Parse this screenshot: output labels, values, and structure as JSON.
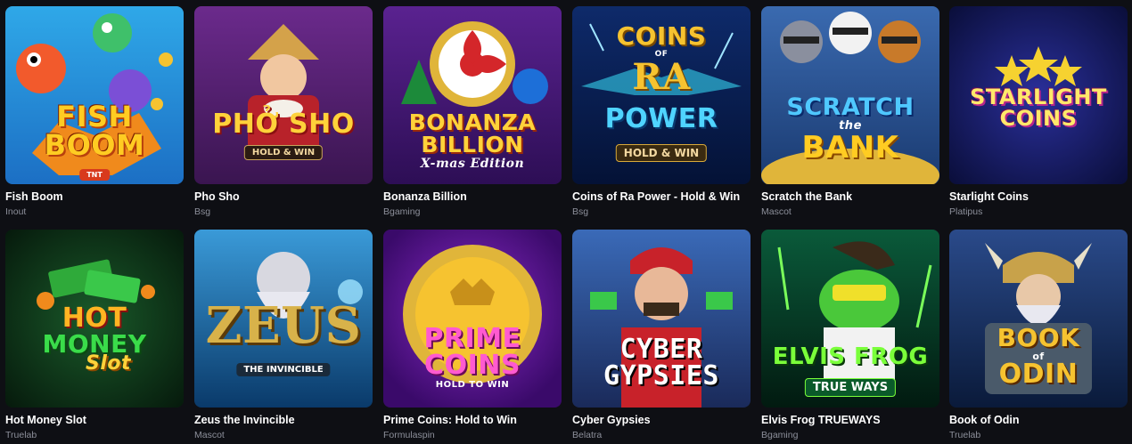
{
  "games": [
    {
      "title": "Fish Boom",
      "provider": "Inout",
      "logo": [
        "FISH",
        "BOOM"
      ],
      "logo_sub": "TNT"
    },
    {
      "title": "Pho Sho",
      "provider": "Bsg",
      "logo": [
        "PHỞ SHO"
      ],
      "badge": "HOLD & WIN"
    },
    {
      "title": "Bonanza Billion",
      "provider": "Bgaming",
      "logo": [
        "BONANZA",
        "BILLION"
      ],
      "logo_sub": "X-mas Edition"
    },
    {
      "title": "Coins of Ra Power - Hold & Win",
      "provider": "Bsg",
      "logo": [
        "COINS",
        "RA",
        "POWER"
      ],
      "logo_of": "OF",
      "badge": "HOLD & WIN"
    },
    {
      "title": "Scratch the Bank",
      "provider": "Mascot",
      "logo": [
        "SCRATCH",
        "BANK"
      ],
      "logo_the": "the"
    },
    {
      "title": "Starlight Coins",
      "provider": "Platipus",
      "logo": [
        "STARLIGHT",
        "COINS"
      ]
    },
    {
      "title": "Hot Money Slot",
      "provider": "Truelab",
      "logo": [
        "HOT",
        "MONEY"
      ],
      "logo_sub": "Slot"
    },
    {
      "title": "Zeus the Invincible",
      "provider": "Mascot",
      "logo": [
        "ZEUS"
      ],
      "logo_sub": "THE INVINCIBLE"
    },
    {
      "title": "Prime Coins: Hold to Win",
      "provider": "Formulaspin",
      "logo": [
        "PRIME",
        "COINS"
      ],
      "logo_sub": "HOLD TO WIN"
    },
    {
      "title": "Cyber Gypsies",
      "provider": "Belatra",
      "logo": [
        "CYBER",
        "GYPSIES"
      ]
    },
    {
      "title": "Elvis Frog TRUEWAYS",
      "provider": "Bgaming",
      "logo": [
        "ELVIS FROG"
      ],
      "badge": "TRUE WAYS"
    },
    {
      "title": "Book of Odin",
      "provider": "Truelab",
      "logo": [
        "BOOK",
        "ODIN"
      ],
      "logo_of": "of"
    }
  ],
  "colors": {
    "background": "#0e0f14",
    "title": "#ffffff",
    "provider": "#8c8f9a"
  },
  "icons": [
    "fish-boom-art",
    "pho-sho-art",
    "bonanza-billion-art",
    "coins-of-ra-art",
    "scratch-the-bank-art",
    "starlight-coins-art",
    "hot-money-art",
    "zeus-art",
    "prime-coins-art",
    "cyber-gypsies-art",
    "elvis-frog-art",
    "book-of-odin-art"
  ]
}
